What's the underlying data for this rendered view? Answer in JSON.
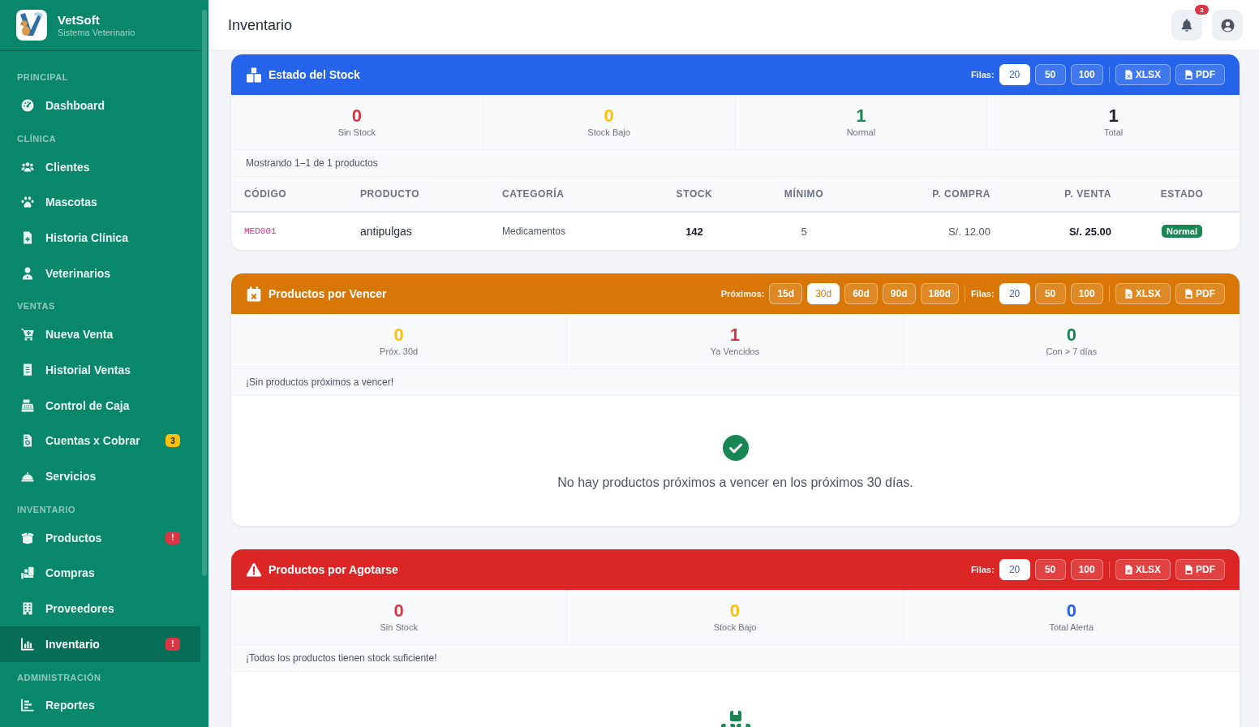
{
  "sidebar": {
    "brand": {
      "name": "VetSoft",
      "subtitle": "Sistema Veterinario"
    },
    "sections": [
      {
        "label": "PRINCIPAL",
        "items": [
          {
            "label": "Dashboard",
            "selected": false
          }
        ]
      },
      {
        "label": "CLÍNICA",
        "items": [
          {
            "label": "Clientes",
            "selected": false
          },
          {
            "label": "Mascotas",
            "selected": false
          },
          {
            "label": "Historia Clínica",
            "selected": false
          },
          {
            "label": "Veterinarios",
            "selected": false
          }
        ]
      },
      {
        "label": "VENTAS",
        "items": [
          {
            "label": "Nueva Venta",
            "selected": false
          },
          {
            "label": "Historial Ventas",
            "selected": false
          },
          {
            "label": "Control de Caja",
            "selected": false
          },
          {
            "label": "Cuentas x Cobrar",
            "selected": false,
            "badge": {
              "text": "3",
              "color": "#ffc107"
            }
          },
          {
            "label": "Servicios",
            "selected": false
          }
        ]
      },
      {
        "label": "INVENTARIO",
        "items": [
          {
            "label": "Productos",
            "selected": false,
            "badge": {
              "text": "!",
              "color": "#dc3545"
            }
          },
          {
            "label": "Compras",
            "selected": false
          },
          {
            "label": "Proveedores",
            "selected": false
          },
          {
            "label": "Inventario",
            "selected": true,
            "badge": {
              "text": "!",
              "color": "#dc3545"
            }
          }
        ]
      },
      {
        "label": "ADMINISTRACIÓN",
        "items": [
          {
            "label": "Reportes",
            "selected": false
          }
        ]
      }
    ]
  },
  "header": {
    "title": "Inventario",
    "notifications": "3"
  },
  "panels": [
    {
      "kind": "table",
      "title": "Estado del Stock",
      "color": "#2563eb",
      "rows_label": "Filas:",
      "rows_options": [
        {
          "label": "20",
          "selected": true
        },
        {
          "label": "50",
          "selected": false
        },
        {
          "label": "100",
          "selected": false
        }
      ],
      "exports": [
        {
          "label": "XLSX",
          "kind": "spreadsheet"
        },
        {
          "label": "PDF",
          "kind": "pdf"
        }
      ],
      "stats": [
        {
          "value": "0",
          "label": "Sin Stock",
          "color": "#dc3545"
        },
        {
          "value": "0",
          "label": "Stock Bajo",
          "color": "#ffc107"
        },
        {
          "value": "1",
          "label": "Normal",
          "color": "#198754"
        },
        {
          "value": "1",
          "label": "Total",
          "color": "#212529"
        }
      ],
      "info": "Mostrando 1–1 de 1 productos",
      "table": {
        "columns": [
          "CÓDIGO",
          "PRODUCTO",
          "CATEGORÍA",
          "STOCK",
          "MÍNIMO",
          "P. COMPRA",
          "P. VENTA",
          "ESTADO"
        ],
        "rows": [
          {
            "cells": [
              "MED001",
              "antipulgas",
              "Medicamentos",
              "142",
              "5",
              "S/. 12.00",
              "S/. 25.00",
              "Normal"
            ]
          }
        ]
      }
    },
    {
      "kind": "empty",
      "title": "Productos por Vencer",
      "color": "#d97706",
      "range_label": "Próximos:",
      "range_options": [
        {
          "label": "15d",
          "selected": false
        },
        {
          "label": "30d",
          "selected": true
        },
        {
          "label": "60d",
          "selected": false
        },
        {
          "label": "90d",
          "selected": false
        },
        {
          "label": "180d",
          "selected": false
        }
      ],
      "rows_label": "Filas:",
      "rows_options": [
        {
          "label": "20",
          "selected": true
        },
        {
          "label": "50",
          "selected": false
        },
        {
          "label": "100",
          "selected": false
        }
      ],
      "exports": [
        {
          "label": "XLSX",
          "kind": "spreadsheet"
        },
        {
          "label": "PDF",
          "kind": "pdf"
        }
      ],
      "stats": [
        {
          "value": "0",
          "label": "Próx. 30d",
          "color": "#ffc107"
        },
        {
          "value": "1",
          "label": "Ya Vencidos",
          "color": "#dc3545"
        },
        {
          "value": "0",
          "label": "Con > 7 días",
          "color": "#198754"
        }
      ],
      "info": "¡Sin productos próximos a vencer!",
      "empty_message": "No hay productos próximos a vencer en los próximos 30 días."
    },
    {
      "kind": "empty",
      "title": "Productos por Agotarse",
      "color": "#dc2626",
      "rows_label": "Filas:",
      "rows_options": [
        {
          "label": "20",
          "selected": true
        },
        {
          "label": "50",
          "selected": false
        },
        {
          "label": "100",
          "selected": false
        }
      ],
      "exports": [
        {
          "label": "XLSX",
          "kind": "spreadsheet"
        },
        {
          "label": "PDF",
          "kind": "pdf"
        }
      ],
      "stats": [
        {
          "value": "0",
          "label": "Sin Stock",
          "color": "#dc3545"
        },
        {
          "value": "0",
          "label": "Stock Bajo",
          "color": "#ffc107"
        },
        {
          "value": "0",
          "label": "Total Alerta",
          "color": "#2563eb"
        }
      ],
      "info": "¡Todos los productos tienen stock suficiente!"
    }
  ]
}
